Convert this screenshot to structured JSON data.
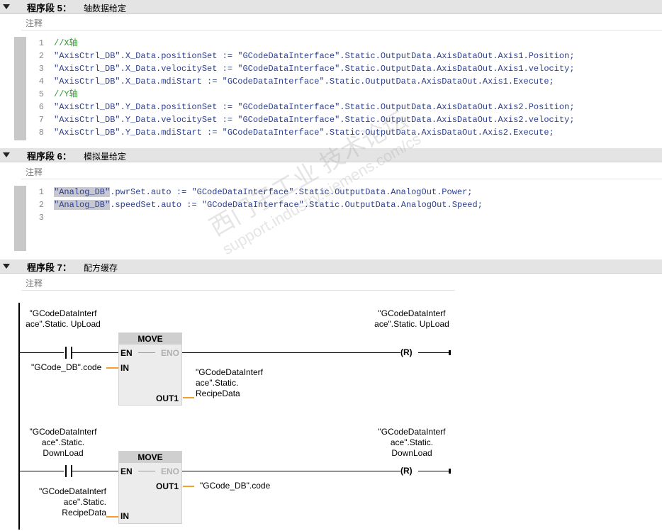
{
  "segments": [
    {
      "title": "程序段 5：",
      "name": "轴数据给定",
      "comment": "注释"
    },
    {
      "title": "程序段 6：",
      "name": "模拟量给定",
      "comment": "注释"
    },
    {
      "title": "程序段 7：",
      "name": "配方缓存",
      "comment": "注释"
    }
  ],
  "code5": [
    {
      "n": "1",
      "a": "//X轴",
      "b": ""
    },
    {
      "n": "2",
      "a": "\"AxisCtrl_DB\".X_Data.positionSet := ",
      "b": "\"GCodeDataInterface\".Static.OutputData.AxisDataOut.Axis1.Position;"
    },
    {
      "n": "3",
      "a": "\"AxisCtrl_DB\".X_Data.velocitySet := ",
      "b": "\"GCodeDataInterface\".Static.OutputData.AxisDataOut.Axis1.velocity;"
    },
    {
      "n": "4",
      "a": "\"AxisCtrl_DB\".X_Data.mdiStart := ",
      "b": "\"GCodeDataInterface\".Static.OutputData.AxisDataOut.Axis1.Execute;"
    },
    {
      "n": "5",
      "a": "//Y轴",
      "b": ""
    },
    {
      "n": "6",
      "a": "\"AxisCtrl_DB\".Y_Data.positionSet := ",
      "b": "\"GCodeDataInterface\".Static.OutputData.AxisDataOut.Axis2.Position;"
    },
    {
      "n": "7",
      "a": "\"AxisCtrl_DB\".Y_Data.velocitySet := ",
      "b": "\"GCodeDataInterface\".Static.OutputData.AxisDataOut.Axis2.velocity;"
    },
    {
      "n": "8",
      "a": "\"AxisCtrl_DB\".Y_Data.mdiStart := ",
      "b": "\"GCodeDataInterface\".Static.OutputData.AxisDataOut.Axis2.Execute;"
    }
  ],
  "code6": [
    {
      "n": "1",
      "h": "\"Analog_DB\"",
      "a": ".pwrSet.auto := ",
      "b": "\"GCodeDataInterface\".Static.OutputData.AnalogOut.Power;"
    },
    {
      "n": "2",
      "h": "\"Analog_DB\"",
      "a": ".speedSet.auto := ",
      "b": "\"GCodeDataInterface\".Static.OutputData.AnalogOut.Speed;"
    },
    {
      "n": "3",
      "h": "",
      "a": "",
      "b": ""
    }
  ],
  "ladder": {
    "move_label": "MOVE",
    "en": "EN",
    "eno": "ENO",
    "in": "IN",
    "out1": "OUT1",
    "coil": "R",
    "rung1": {
      "contact": "\"GCodeDataInterf ace\".Static. UpLoad",
      "in_var": "\"GCode_DB\".code",
      "out_var": "\"GCodeDataInterf ace\".Static. RecipeData",
      "coil_var": "\"GCodeDataInterf ace\".Static. UpLoad"
    },
    "rung2": {
      "contact": "\"GCodeDataInterf ace\".Static. DownLoad",
      "in_var": "\"GCodeDataInterf ace\".Static. RecipeData",
      "out_var": "\"GCode_DB\".code",
      "coil_var": "\"GCodeDataInterf ace\".Static. DownLoad"
    }
  },
  "watermark": {
    "line1": "西门子工业 技术论坛",
    "line2": "support.industry.siemens.com/cs"
  }
}
